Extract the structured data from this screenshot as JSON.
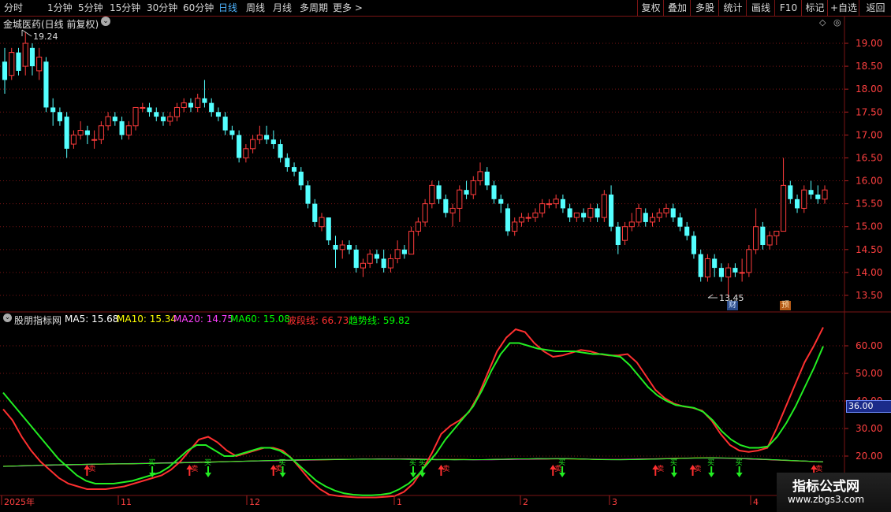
{
  "toolbar": {
    "periods": [
      "分时",
      "1分钟",
      "5分钟",
      "15分钟",
      "30分钟",
      "60分钟",
      "日线",
      "周线",
      "月线",
      "多周期",
      "更多 >"
    ],
    "active_period": "日线",
    "right_buttons": [
      "复权",
      "叠加",
      "多股",
      "统计",
      "画线",
      "F10",
      "标记",
      "+自选",
      "返回"
    ]
  },
  "main_panel": {
    "title": "金城医药(日线 前复权)",
    "high_label": "19.24",
    "low_label": "13.45",
    "marker_cai": "财",
    "marker_yu": "预",
    "y_axis": [
      "19.00",
      "18.50",
      "18.00",
      "17.50",
      "17.00",
      "16.50",
      "16.00",
      "15.50",
      "15.00",
      "14.50",
      "14.00",
      "13.50"
    ]
  },
  "indicator_panel": {
    "name": "股朋指标网",
    "legend": [
      {
        "label": "MA5: 15.68",
        "color": "#ffffff"
      },
      {
        "label": "MA10: 15.34",
        "color": "#ffff00"
      },
      {
        "label": "MA20: 14.75",
        "color": "#ff40ff"
      },
      {
        "label": "MA60: 15.08",
        "color": "#00ff00"
      },
      {
        "label": "波段线: 66.73",
        "color": "#ff3030"
      },
      {
        "label": "趋势线: 59.82",
        "color": "#00ff00"
      }
    ],
    "y_axis": [
      "60.00",
      "50.00",
      "40.00",
      "30.00",
      "20.00"
    ],
    "current_value_tag": "36.00",
    "buy_label": "买",
    "sell_label": "卖"
  },
  "x_axis": [
    "2025年",
    "11",
    "12",
    "1",
    "2",
    "3",
    "4"
  ],
  "watermark": {
    "title": "指标公式网",
    "url": "www.zbgs3.com"
  },
  "colors": {
    "up": "#ff3c3c",
    "down": "#54ffff",
    "border": "#7a1414",
    "band": "#ff3030",
    "trend": "#22ee22"
  },
  "chart_data": {
    "type": "candlestick",
    "price_range": [
      13.2,
      19.5
    ],
    "candles": [
      [
        18.6,
        18.9,
        17.9,
        18.2
      ],
      [
        18.3,
        18.9,
        18.2,
        18.8
      ],
      [
        18.8,
        18.9,
        18.3,
        18.4
      ],
      [
        18.5,
        19.24,
        18.3,
        19.0
      ],
      [
        18.9,
        19.0,
        18.3,
        18.5
      ],
      [
        18.4,
        18.9,
        18.2,
        18.7
      ],
      [
        18.6,
        18.7,
        17.5,
        17.6
      ],
      [
        17.6,
        17.8,
        17.2,
        17.5
      ],
      [
        17.5,
        17.6,
        17.2,
        17.3
      ],
      [
        17.4,
        17.5,
        16.5,
        16.7
      ],
      [
        16.8,
        17.1,
        16.7,
        17.0
      ],
      [
        17.0,
        17.3,
        16.9,
        17.1
      ],
      [
        17.1,
        17.2,
        16.8,
        17.0
      ],
      [
        16.9,
        17.1,
        16.7,
        16.9
      ],
      [
        16.9,
        17.3,
        16.8,
        17.2
      ],
      [
        17.2,
        17.5,
        17.1,
        17.4
      ],
      [
        17.4,
        17.5,
        17.2,
        17.3
      ],
      [
        17.3,
        17.4,
        16.9,
        17.0
      ],
      [
        17.0,
        17.3,
        16.9,
        17.2
      ],
      [
        17.2,
        17.6,
        17.1,
        17.6
      ],
      [
        17.6,
        17.7,
        17.5,
        17.6
      ],
      [
        17.6,
        17.7,
        17.4,
        17.5
      ],
      [
        17.5,
        17.6,
        17.3,
        17.4
      ],
      [
        17.4,
        17.5,
        17.2,
        17.3
      ],
      [
        17.3,
        17.5,
        17.2,
        17.4
      ],
      [
        17.4,
        17.7,
        17.3,
        17.6
      ],
      [
        17.6,
        17.8,
        17.5,
        17.7
      ],
      [
        17.7,
        17.8,
        17.5,
        17.6
      ],
      [
        17.6,
        17.9,
        17.5,
        17.8
      ],
      [
        17.8,
        18.2,
        17.6,
        17.7
      ],
      [
        17.7,
        17.8,
        17.4,
        17.5
      ],
      [
        17.5,
        17.6,
        17.3,
        17.4
      ],
      [
        17.4,
        17.5,
        17.0,
        17.1
      ],
      [
        17.1,
        17.2,
        16.9,
        17.0
      ],
      [
        17.0,
        17.1,
        16.4,
        16.5
      ],
      [
        16.5,
        16.8,
        16.4,
        16.7
      ],
      [
        16.7,
        17.0,
        16.6,
        16.9
      ],
      [
        16.9,
        17.2,
        16.8,
        17.0
      ],
      [
        17.0,
        17.2,
        16.8,
        16.9
      ],
      [
        16.9,
        17.1,
        16.7,
        16.8
      ],
      [
        16.8,
        16.9,
        16.4,
        16.5
      ],
      [
        16.5,
        16.6,
        16.2,
        16.3
      ],
      [
        16.3,
        16.4,
        16.1,
        16.2
      ],
      [
        16.2,
        16.3,
        15.8,
        15.9
      ],
      [
        15.9,
        16.0,
        15.4,
        15.5
      ],
      [
        15.5,
        15.6,
        15.0,
        15.1
      ],
      [
        15.0,
        15.3,
        14.9,
        15.2
      ],
      [
        15.2,
        15.2,
        14.6,
        14.7
      ],
      [
        14.6,
        14.8,
        14.1,
        14.5
      ],
      [
        14.5,
        14.7,
        14.3,
        14.6
      ],
      [
        14.6,
        14.7,
        14.4,
        14.5
      ],
      [
        14.5,
        14.6,
        14.0,
        14.1
      ],
      [
        14.1,
        14.3,
        13.9,
        14.2
      ],
      [
        14.2,
        14.5,
        14.1,
        14.4
      ],
      [
        14.4,
        14.5,
        14.2,
        14.3
      ],
      [
        14.3,
        14.5,
        14.0,
        14.1
      ],
      [
        14.1,
        14.4,
        14.0,
        14.3
      ],
      [
        14.3,
        14.7,
        14.2,
        14.5
      ],
      [
        14.5,
        14.6,
        14.3,
        14.4
      ],
      [
        14.4,
        15.0,
        14.4,
        14.9
      ],
      [
        14.9,
        15.2,
        14.8,
        15.1
      ],
      [
        15.1,
        15.6,
        15.0,
        15.5
      ],
      [
        15.5,
        16.0,
        15.4,
        15.9
      ],
      [
        15.9,
        16.0,
        15.5,
        15.6
      ],
      [
        15.6,
        15.7,
        15.2,
        15.3
      ],
      [
        15.3,
        15.5,
        15.0,
        15.4
      ],
      [
        15.4,
        15.9,
        15.1,
        15.8
      ],
      [
        15.8,
        16.0,
        15.6,
        15.7
      ],
      [
        15.7,
        16.1,
        15.6,
        16.0
      ],
      [
        16.0,
        16.4,
        15.9,
        16.2
      ],
      [
        16.2,
        16.3,
        15.8,
        15.9
      ],
      [
        15.9,
        16.0,
        15.5,
        15.6
      ],
      [
        15.6,
        15.7,
        15.3,
        15.5
      ],
      [
        15.4,
        15.5,
        14.8,
        14.9
      ],
      [
        14.9,
        15.2,
        14.8,
        15.1
      ],
      [
        15.1,
        15.3,
        15.0,
        15.2
      ],
      [
        15.2,
        15.3,
        15.1,
        15.2
      ],
      [
        15.2,
        15.4,
        15.1,
        15.3
      ],
      [
        15.3,
        15.6,
        15.2,
        15.5
      ],
      [
        15.5,
        15.6,
        15.4,
        15.5
      ],
      [
        15.5,
        15.7,
        15.4,
        15.6
      ],
      [
        15.6,
        15.7,
        15.3,
        15.4
      ],
      [
        15.4,
        15.5,
        15.1,
        15.2
      ],
      [
        15.2,
        15.3,
        15.1,
        15.3
      ],
      [
        15.3,
        15.4,
        15.1,
        15.2
      ],
      [
        15.2,
        15.5,
        15.1,
        15.4
      ],
      [
        15.4,
        15.5,
        15.1,
        15.2
      ],
      [
        15.2,
        15.8,
        15.1,
        15.7
      ],
      [
        15.7,
        15.9,
        14.9,
        15.0
      ],
      [
        15.0,
        15.1,
        14.4,
        14.6
      ],
      [
        14.7,
        15.1,
        14.6,
        15.0
      ],
      [
        15.0,
        15.3,
        14.9,
        15.1
      ],
      [
        15.1,
        15.5,
        15.0,
        15.4
      ],
      [
        15.3,
        15.4,
        15.0,
        15.1
      ],
      [
        15.1,
        15.3,
        15.0,
        15.2
      ],
      [
        15.2,
        15.4,
        15.1,
        15.3
      ],
      [
        15.3,
        15.5,
        15.2,
        15.4
      ],
      [
        15.4,
        15.5,
        15.1,
        15.2
      ],
      [
        15.2,
        15.3,
        14.9,
        15.0
      ],
      [
        15.0,
        15.1,
        14.7,
        14.8
      ],
      [
        14.8,
        14.9,
        14.3,
        14.4
      ],
      [
        14.4,
        14.5,
        13.8,
        13.9
      ],
      [
        13.9,
        14.4,
        13.8,
        14.3
      ],
      [
        14.3,
        14.4,
        13.9,
        14.1
      ],
      [
        14.1,
        14.2,
        13.8,
        13.9
      ],
      [
        13.9,
        14.2,
        13.45,
        14.1
      ],
      [
        14.1,
        14.2,
        13.9,
        14.0
      ],
      [
        14.0,
        14.3,
        13.8,
        14.0
      ],
      [
        14.0,
        14.6,
        13.9,
        14.5
      ],
      [
        14.5,
        15.4,
        14.4,
        15.0
      ],
      [
        15.0,
        15.1,
        14.5,
        14.6
      ],
      [
        14.6,
        14.9,
        14.5,
        14.8
      ],
      [
        14.8,
        14.9,
        14.6,
        14.9
      ],
      [
        14.9,
        16.5,
        14.9,
        15.9
      ],
      [
        15.9,
        16.0,
        15.5,
        15.6
      ],
      [
        15.6,
        15.7,
        15.3,
        15.4
      ],
      [
        15.4,
        15.9,
        15.3,
        15.8
      ],
      [
        15.8,
        16.0,
        15.6,
        15.7
      ],
      [
        15.7,
        15.9,
        15.5,
        15.6
      ],
      [
        15.6,
        15.9,
        15.5,
        15.8
      ]
    ],
    "indicator_range": [
      5,
      70
    ],
    "band_line": [
      37,
      33,
      27,
      22,
      18,
      15,
      12,
      10,
      9,
      8,
      8,
      8,
      8.5,
      9,
      10,
      11,
      12,
      13,
      15,
      18,
      22,
      26,
      27,
      25,
      22,
      20,
      21,
      22,
      23,
      23,
      22,
      19,
      15,
      11,
      8,
      6,
      5.5,
      5.2,
      5,
      5,
      5,
      5.2,
      5.5,
      7,
      10,
      15,
      21,
      28,
      31,
      33,
      36,
      42,
      50,
      58,
      63,
      66,
      65,
      61,
      58,
      56,
      56.5,
      57.5,
      58.5,
      58,
      57,
      56.5,
      56.5,
      57,
      54,
      49,
      44,
      41,
      39,
      38,
      37.5,
      36.5,
      33,
      28,
      24,
      22,
      21.5,
      22,
      23,
      30,
      38,
      46,
      54,
      60,
      66.7
    ],
    "trend_line": [
      43,
      39,
      35,
      31,
      27,
      23,
      19,
      16,
      13,
      11,
      10,
      10,
      10,
      10.5,
      11,
      12,
      13,
      14,
      16,
      19,
      22,
      24,
      24,
      22,
      20,
      20,
      21,
      22,
      23,
      23,
      22,
      20,
      17,
      14,
      11,
      9,
      7.5,
      6.5,
      6,
      5.8,
      5.8,
      6,
      6.5,
      8,
      10,
      13,
      17,
      21,
      26,
      30,
      34,
      38,
      44,
      51,
      57,
      61,
      61,
      60,
      59,
      58.5,
      58,
      58,
      58,
      57.5,
      57,
      57,
      56.5,
      56,
      53,
      49,
      45,
      42,
      40,
      38.5,
      38,
      37.5,
      36,
      33,
      29,
      26,
      24,
      23,
      23,
      23.5,
      27,
      32,
      38,
      45,
      52,
      59.8
    ],
    "ma_line": [
      19.6,
      19.5,
      19.4,
      19.3,
      19.1,
      19.0,
      18.9,
      18.8,
      18.7,
      18.6,
      18.4,
      18.3,
      18.2,
      18.1,
      18.0,
      17.9,
      17.8,
      17.6,
      17.5,
      17.4,
      17.3,
      17.2,
      17.1,
      17.0,
      16.9,
      16.8,
      16.7,
      16.6,
      16.5,
      16.4,
      16.3,
      16.2,
      16.1,
      16.0,
      15.9,
      15.8,
      15.7,
      15.6,
      15.5,
      15.4,
      15.4,
      15.3,
      15.3,
      15.3,
      15.3,
      15.4,
      15.5,
      15.6,
      15.6,
      15.7,
      15.7,
      15.8,
      15.8,
      15.8,
      15.7,
      15.6,
      15.5,
      15.5,
      15.4,
      15.4,
      15.3,
      15.3,
      15.3,
      15.4,
      15.5,
      15.6,
      15.6,
      15.6,
      15.5,
      15.4,
      15.3,
      15.2,
      15.1,
      15.0,
      14.9,
      14.8,
      14.8,
      14.8,
      14.9,
      15.0,
      15.2,
      15.4,
      15.6,
      15.8,
      16.0,
      16.2,
      16.4,
      16.6,
      16.8,
      17.0
    ],
    "buy_signals": [
      16,
      22,
      30,
      44,
      45,
      60,
      72,
      76,
      79
    ],
    "sell_signals": [
      9,
      20,
      29,
      47,
      59,
      70,
      74,
      87
    ]
  }
}
